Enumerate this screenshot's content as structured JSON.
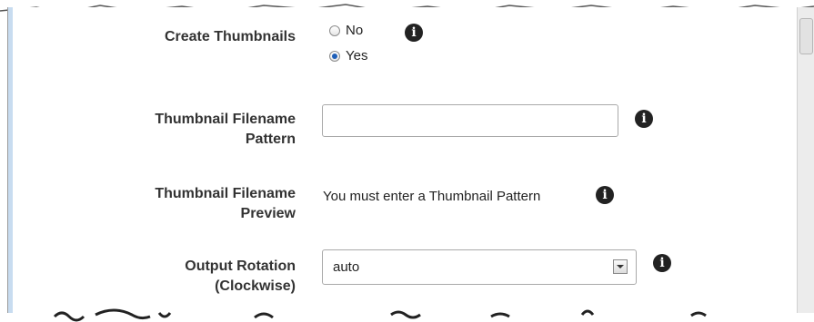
{
  "form": {
    "create_thumbnails": {
      "label": "Create Thumbnails",
      "options": [
        "No",
        "Yes"
      ],
      "selected": "Yes"
    },
    "thumbnail_pattern": {
      "label_line1": "Thumbnail Filename",
      "label_line2": "Pattern",
      "value": ""
    },
    "thumbnail_preview": {
      "label_line1": "Thumbnail Filename",
      "label_line2": "Preview",
      "text": "You must enter a Thumbnail Pattern"
    },
    "output_rotation": {
      "label_line1": "Output Rotation",
      "label_line2": "(Clockwise)",
      "selected": "auto"
    },
    "info_icon": "i"
  }
}
